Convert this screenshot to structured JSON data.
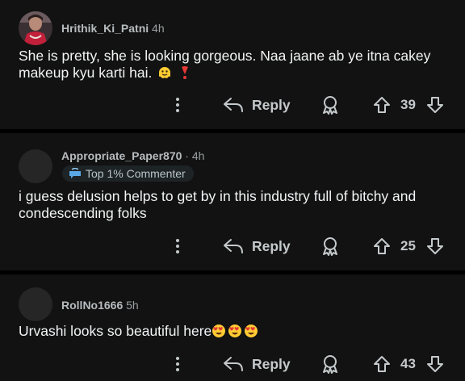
{
  "comments": [
    {
      "username": "Hrithik_Ki_Patni",
      "time": "4h",
      "separator": "",
      "badge": "",
      "body": "She is pretty, she is looking gorgeous. Naa jaane ab ye itna cakey makeup kyu karti hai.",
      "emojis": [
        "melting-face",
        "red-exclamation"
      ],
      "reply_label": "Reply",
      "score": "39",
      "avatar": "photo"
    },
    {
      "username": "Appropriate_Paper870",
      "time": "4h",
      "separator": "·",
      "badge": "Top 1% Commenter",
      "body": "i guess delusion helps to get by in this industry full of bitchy and condescending folks",
      "emojis": [],
      "reply_label": "Reply",
      "score": "25",
      "avatar": "blank"
    },
    {
      "username": "RollNo1666",
      "time": "5h",
      "separator": "",
      "badge": "",
      "body": "Urvashi looks so beautiful here",
      "emojis": [
        "heart-eyes",
        "heart-eyes",
        "heart-eyes"
      ],
      "reply_label": "Reply",
      "score": "43",
      "avatar": "blank"
    }
  ],
  "icons": {
    "more": "more-vertical-icon",
    "reply": "reply-arrow-icon",
    "award": "award-icon",
    "upvote": "upvote-arrow-icon",
    "downvote": "downvote-arrow-icon",
    "badge": "top-commenter-icon"
  },
  "colors": {
    "background": "#000000",
    "card": "#121212",
    "text": "#f2f4f5",
    "muted": "#b7bcbe",
    "badge_bg": "#1e2326"
  }
}
